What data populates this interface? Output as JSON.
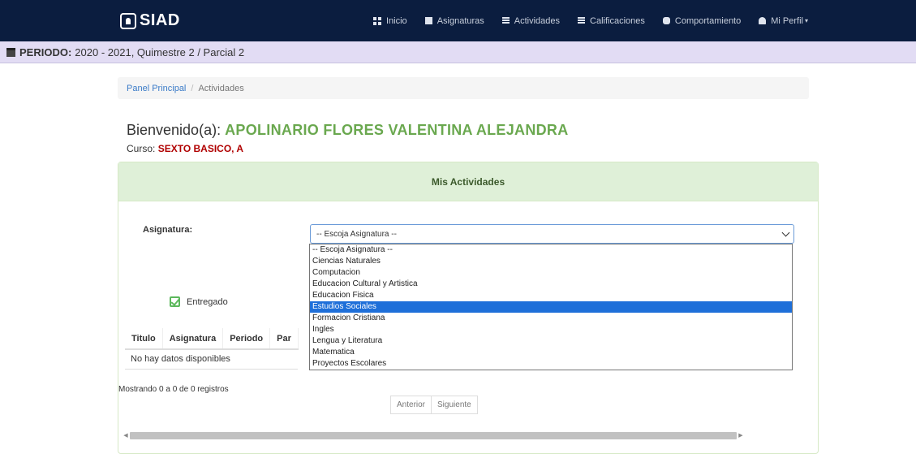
{
  "navbar": {
    "brand": "SIAD",
    "items": [
      {
        "label": "Inicio",
        "icon": "grid-icon"
      },
      {
        "label": "Asignaturas",
        "icon": "book-icon"
      },
      {
        "label": "Actividades",
        "icon": "list-icon"
      },
      {
        "label": "Calificaciones",
        "icon": "table-icon"
      },
      {
        "label": "Comportamiento",
        "icon": "comment-icon"
      },
      {
        "label": "Mi Perfil",
        "icon": "user-icon"
      }
    ]
  },
  "period": {
    "label": "PERIODO:",
    "value": "2020 - 2021, Quimestre 2 / Parcial 2"
  },
  "breadcrumb": {
    "home": "Panel Principal",
    "separator": "/",
    "current": "Actividades"
  },
  "welcome": {
    "prefix": "Bienvenido(a):",
    "name": "APOLINARIO FLORES VALENTINA ALEJANDRA"
  },
  "course": {
    "label": "Curso:",
    "value": "SEXTO BASICO, A"
  },
  "panel": {
    "title": "Mis Actividades",
    "subject_label": "Asignatura:",
    "select_value": "-- Escoja Asignatura --",
    "options": [
      "-- Escoja Asignatura --",
      "Ciencias Naturales",
      "Computacion",
      "Educacion Cultural y Artistica",
      "Educacion Fisica",
      "Estudios Sociales",
      "Formacion Cristiana",
      "Ingles",
      "Lengua y Literatura",
      "Matematica",
      "Proyectos Escolares"
    ],
    "highlighted_option": "Estudios Sociales",
    "legend": "Entregado"
  },
  "table": {
    "headers": [
      "Titulo",
      "Asignatura",
      "Periodo",
      "Par"
    ],
    "empty": "No hay datos disponibles",
    "showing": "Mostrando 0 a 0 de 0 registros",
    "prev": "Anterior",
    "next": "Siguiente"
  },
  "colors": {
    "navbar": "#0b1d3f",
    "period_bar": "#e2dcf4",
    "panel_header": "#dff0d8",
    "name_green": "#6aa84f",
    "course_red": "#b00000",
    "option_highlight": "#1e6fd9"
  }
}
